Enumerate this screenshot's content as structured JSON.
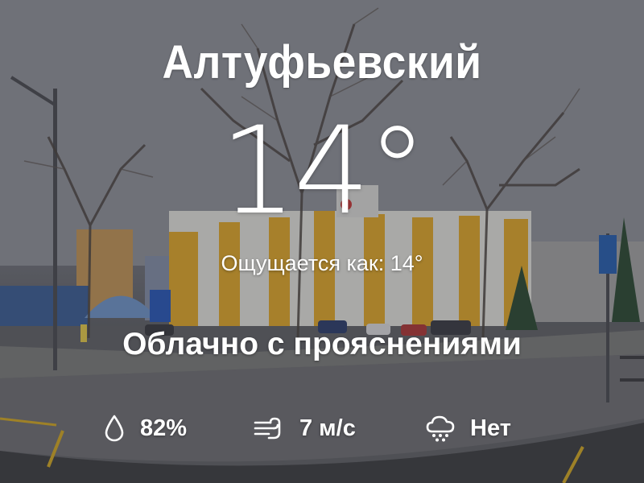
{
  "weather": {
    "city": "Алтуфьевский",
    "temperature": "14°",
    "feels_like": "Ощущается как: 14°",
    "condition": "Облачно с прояснениями",
    "humidity": "82%",
    "wind": "7 м/с",
    "precipitation": "Нет"
  },
  "icons": {
    "humidity": "droplet-icon",
    "wind": "wind-icon",
    "precipitation": "cloud-rain-icon"
  },
  "colors": {
    "text": "#ffffff"
  }
}
